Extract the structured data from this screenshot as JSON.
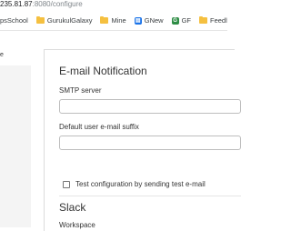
{
  "browser": {
    "url_host": "235.81.87",
    "url_path": ":8080/configure",
    "bookmarks": [
      {
        "label": "psSchool",
        "icon": "none"
      },
      {
        "label": "GurukulGalaxy",
        "icon": "folder-icon"
      },
      {
        "label": "Mine",
        "icon": "folder-icon"
      },
      {
        "label": "GNew",
        "icon": "news-icon",
        "color": "#1a73e8"
      },
      {
        "label": "GF",
        "icon": "gfg-icon",
        "color": "#2f8d46"
      },
      {
        "label": "Feedly",
        "icon": "folder-icon"
      }
    ]
  },
  "page": {
    "side_mark": "e"
  },
  "email": {
    "title": "E-mail Notification",
    "smtp_label": "SMTP server",
    "smtp_value": "",
    "suffix_label": "Default user e-mail suffix",
    "suffix_value": "",
    "test_label": "Test configuration by sending test e-mail",
    "test_checked": false
  },
  "slack": {
    "title": "Slack",
    "workspace_label": "Workspace"
  }
}
